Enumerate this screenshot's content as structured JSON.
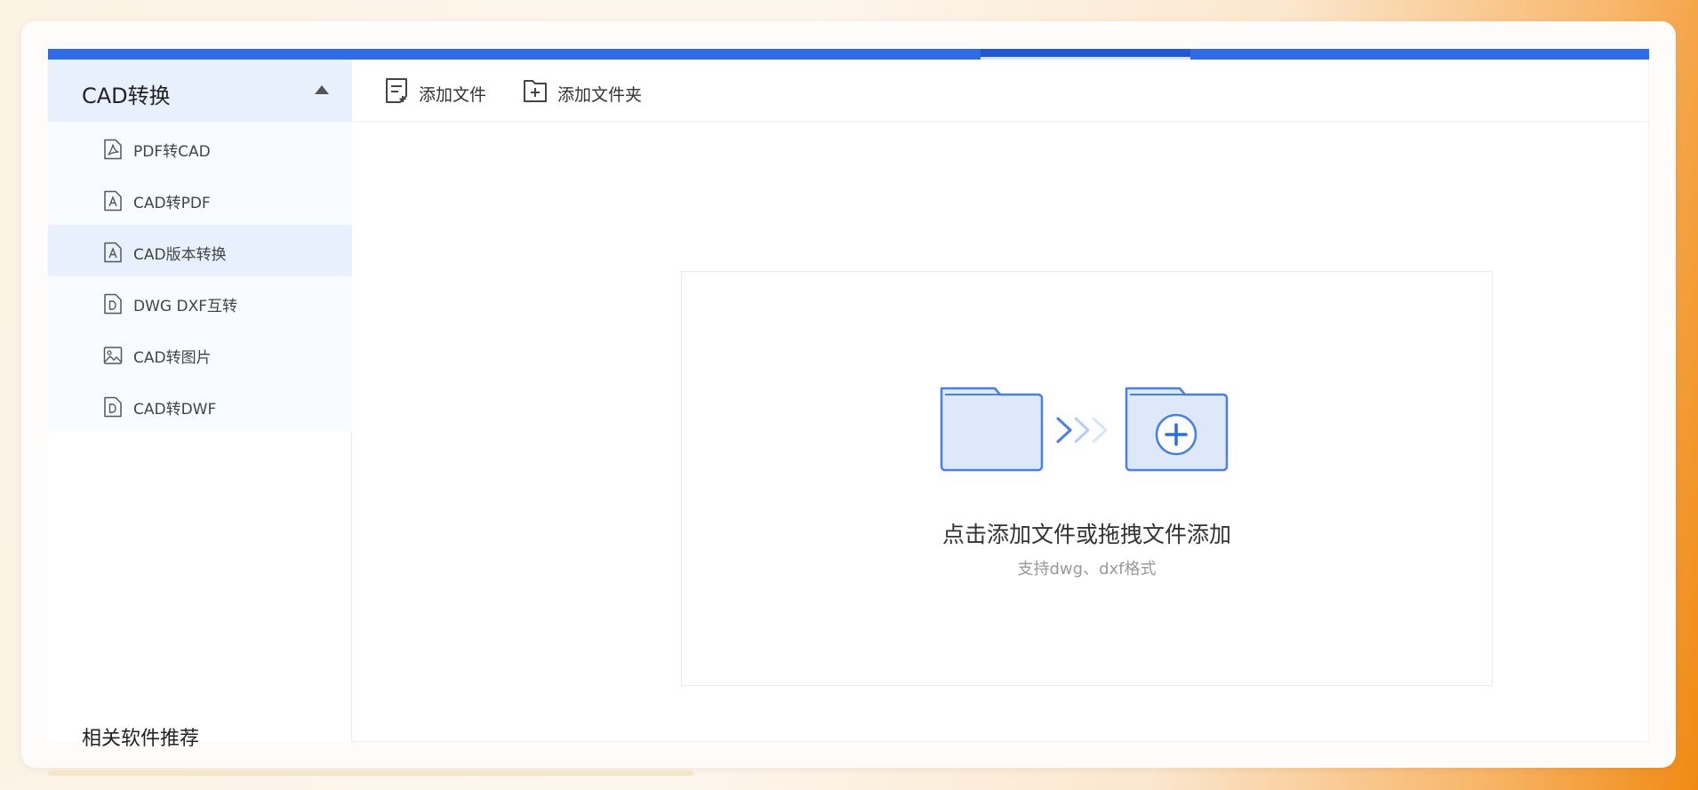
{
  "sidebar": {
    "group_title": "CAD转换",
    "items": [
      {
        "label": "PDF转CAD",
        "icon": "pdf-file-icon"
      },
      {
        "label": "CAD转PDF",
        "icon": "a-file-icon"
      },
      {
        "label": "CAD版本转换",
        "icon": "a-file-icon",
        "active": true
      },
      {
        "label": "DWG DXF互转",
        "icon": "d-file-icon"
      },
      {
        "label": "CAD转图片",
        "icon": "image-icon"
      },
      {
        "label": "CAD转DWF",
        "icon": "d-file-icon"
      }
    ],
    "related_title": "相关软件推荐"
  },
  "toolbar": {
    "add_file_label": "添加文件",
    "add_folder_label": "添加文件夹"
  },
  "drop_zone": {
    "title": "点击添加文件或拖拽文件添加",
    "subtitle": "支持dwg、dxf格式"
  },
  "colors": {
    "accent": "#2f6be6",
    "active_bg": "#e8f0fe",
    "folder_fill": "#dde8fb",
    "folder_stroke": "#4a7fe0"
  }
}
